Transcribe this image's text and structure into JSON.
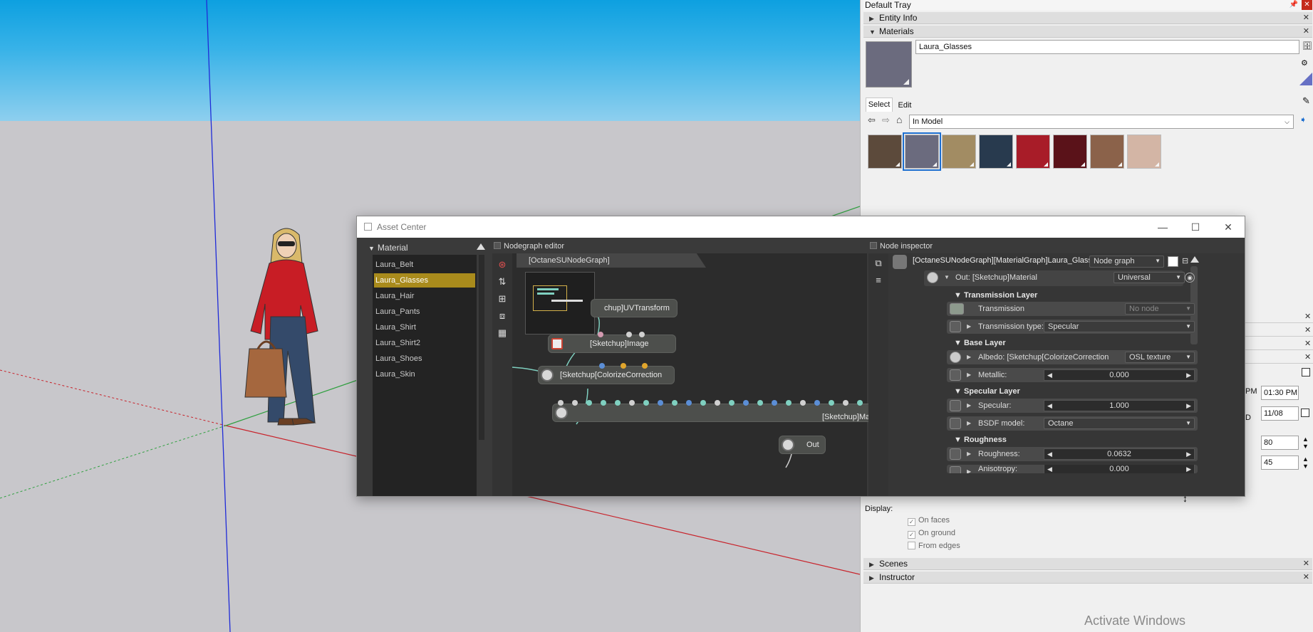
{
  "tray": {
    "title": "Default Tray",
    "entity_info": "Entity Info",
    "materials": "Materials",
    "material_name": "Laura_Glasses",
    "tab_select": "Select",
    "tab_edit": "Edit",
    "collection": "In Model",
    "swatch_colors": [
      "#5c4a3b",
      "#6b6b7e",
      "#a28c63",
      "#283a4e",
      "#a81c28",
      "#5a1219",
      "#8b624a",
      "#d3b5a5"
    ],
    "right_panel": {
      "time": "01:30 PM",
      "date": "11/08",
      "value1": "80",
      "value2": "45",
      "pm_fragment": "PM",
      "d_fragment": "D"
    },
    "display_label": "Display:",
    "on_faces": "On faces",
    "on_ground": "On ground",
    "from_edges": "From edges",
    "scenes": "Scenes",
    "instructor": "Instructor",
    "watermark": "Activate Windows"
  },
  "asset_center": {
    "title": "Asset Center",
    "material_header": "Material",
    "materials": [
      "Laura_Belt",
      "Laura_Glasses",
      "Laura_Hair",
      "Laura_Pants",
      "Laura_Shirt",
      "Laura_Shirt2",
      "Laura_Shoes",
      "Laura_Skin"
    ],
    "selected_index": 1,
    "nodegraph_editor": "Nodegraph editor",
    "graph_tab": "[OctaneSUNodeGraph][MaterialGraph]Laura_Glasses",
    "nodes": {
      "uv_transform": "chup]UVTransform",
      "image": "[Sketchup]Image",
      "colorize": "[Sketchup[ColorizeCorrection",
      "material": "[Sketchup]Ma",
      "out": "Out"
    },
    "node_inspector": "Node inspector",
    "inspector_path": "[OctaneSUNodeGraph][MaterialGraph]Laura_Glasses",
    "inspector_mode": "Node graph",
    "out_label": "Out: [Sketchup]Material",
    "out_mode": "Universal",
    "sections": {
      "transmission": "Transmission Layer",
      "base": "Base Layer",
      "specular": "Specular Layer",
      "roughness": "Roughness"
    },
    "params": {
      "transmission": "Transmission",
      "transmission_value": "No node",
      "transmission_type": "Transmission type:",
      "transmission_type_value": "Specular",
      "albedo": "Albedo: [Sketchup[ColorizeCorrection",
      "albedo_value": "OSL texture",
      "metallic": "Metallic:",
      "metallic_value": "0.000",
      "specular": "Specular:",
      "specular_value": "1.000",
      "bsdf": "BSDF model:",
      "bsdf_value": "Octane",
      "roughness": "Roughness:",
      "roughness_value": "0.0632",
      "anisotropy": "Anisotropy:",
      "anisotropy_value": "0.000"
    }
  }
}
